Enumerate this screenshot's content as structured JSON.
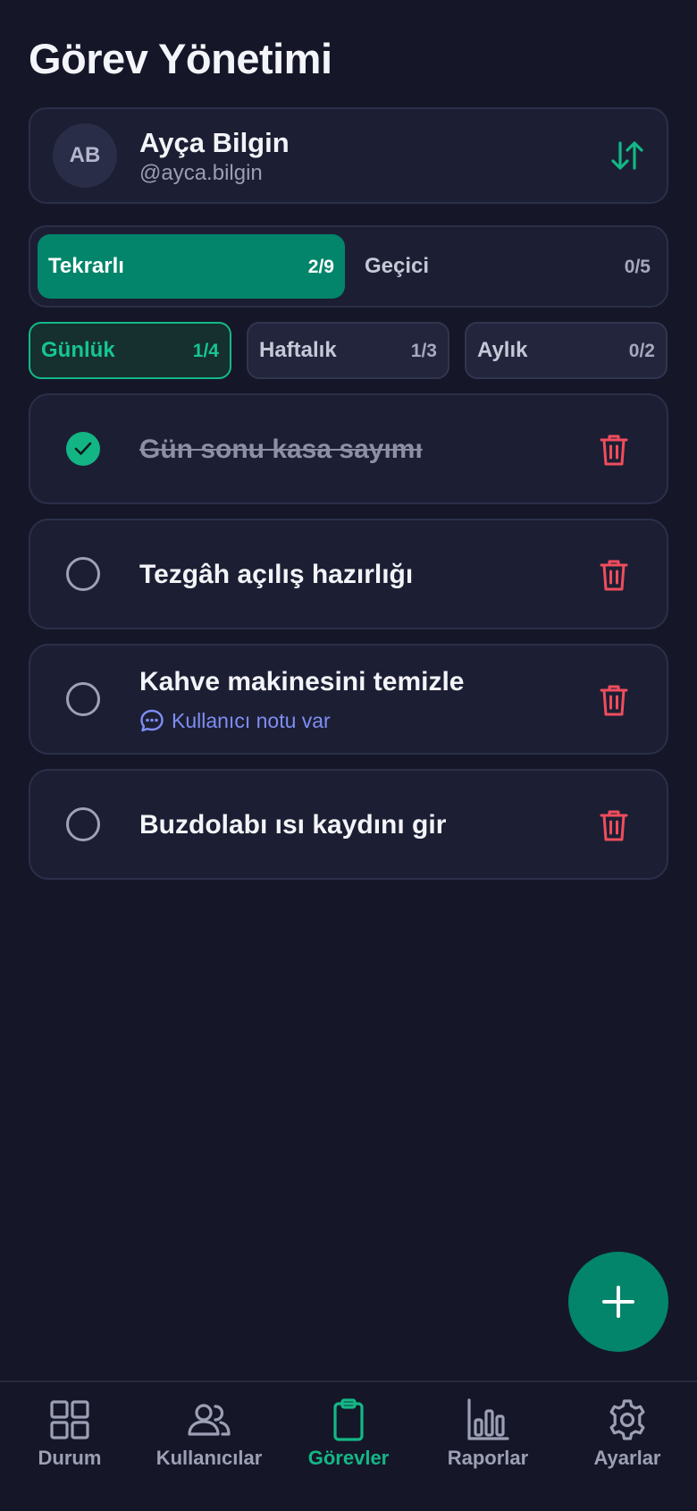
{
  "page": {
    "title": "Görev Yönetimi"
  },
  "user": {
    "initials": "AB",
    "name": "Ayça Bilgin",
    "handle": "@ayca.bilgin"
  },
  "segments": [
    {
      "label": "Tekrarlı",
      "count": "2/9",
      "active": true
    },
    {
      "label": "Geçici",
      "count": "0/5",
      "active": false
    }
  ],
  "filters": [
    {
      "label": "Günlük",
      "count": "1/4",
      "active": true
    },
    {
      "label": "Haftalık",
      "count": "1/3",
      "active": false
    },
    {
      "label": "Aylık",
      "count": "0/2",
      "active": false
    }
  ],
  "tasks": [
    {
      "title": "Gün sonu kasa sayımı",
      "done": true,
      "note": ""
    },
    {
      "title": "Tezgâh açılış hazırlığı",
      "done": false,
      "note": ""
    },
    {
      "title": "Kahve makinesini temizle",
      "done": false,
      "note": "Kullanıcı notu var"
    },
    {
      "title": "Buzdolabı ısı kaydını gir",
      "done": false,
      "note": ""
    }
  ],
  "nav": [
    {
      "label": "Durum",
      "icon": "grid-icon",
      "active": false
    },
    {
      "label": "Kullanıcılar",
      "icon": "users-icon",
      "active": false
    },
    {
      "label": "Görevler",
      "icon": "clipboard-icon",
      "active": true
    },
    {
      "label": "Raporlar",
      "icon": "bar-chart-icon",
      "active": false
    },
    {
      "label": "Ayarlar",
      "icon": "gear-icon",
      "active": false
    }
  ],
  "colors": {
    "background": "#151728",
    "accent": "#02856a",
    "accent_text": "#14b786",
    "danger": "#f04d5e",
    "note": "#7f8df5"
  },
  "icons": {
    "swap": "swap-vertical-icon",
    "delete": "trash-icon",
    "note": "chat-bubble-icon",
    "add": "plus-icon",
    "check": "checkmark-icon"
  }
}
